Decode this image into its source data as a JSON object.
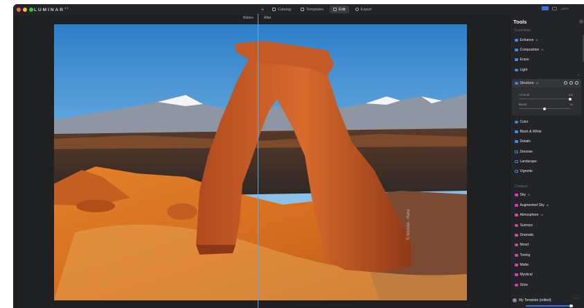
{
  "app": {
    "name": "LUMINAR",
    "version": "4.3"
  },
  "window": {
    "lights": [
      "#ff5f57",
      "#febc2e",
      "#28c840"
    ]
  },
  "nav": {
    "items": [
      {
        "label": "Catalog",
        "icon": "catalog-icon",
        "active": false
      },
      {
        "label": "Templates",
        "icon": "templates-icon",
        "active": false
      },
      {
        "label": "Edit",
        "icon": "edit-icon",
        "active": true
      },
      {
        "label": "Export",
        "icon": "export-icon",
        "active": false
      }
    ],
    "zoom": "100%"
  },
  "compare": {
    "before": "Before",
    "after": "After"
  },
  "photo": {
    "credit": "© Nicolás - Kenz"
  },
  "panel": {
    "title": "Tools",
    "sections": [
      {
        "name": "Essentials",
        "items": [
          {
            "label": "Enhance",
            "ai": "AI",
            "color": "#3c8dde"
          },
          {
            "label": "Composition",
            "ai": "AI",
            "color": "#3c8dde"
          },
          {
            "label": "Erase",
            "ai": "",
            "color": "#3c8dde"
          },
          {
            "label": "Light",
            "ai": "",
            "color": "#3c8dde"
          },
          {
            "label": "Structure",
            "ai": "AI",
            "color": "#3c8dde"
          },
          {
            "label": "Color",
            "ai": "",
            "color": "#3c8dde"
          },
          {
            "label": "Black & White",
            "ai": "",
            "color": "#3c8dde"
          },
          {
            "label": "Details",
            "ai": "",
            "color": "#3c8dde"
          },
          {
            "label": "Denoise",
            "ai": "",
            "color": "#3c8dde"
          },
          {
            "label": "Landscape",
            "ai": "",
            "color": "#3c8dde"
          },
          {
            "label": "Vignette",
            "ai": "",
            "color": "#3c8dde"
          }
        ]
      },
      {
        "name": "Creative",
        "items": [
          {
            "label": "Sky",
            "ai": "AI",
            "color": "#d1489e"
          },
          {
            "label": "Augmented Sky",
            "ai": "AI",
            "color": "#d1489e"
          },
          {
            "label": "Atmosphere",
            "ai": "AI",
            "color": "#d1489e"
          },
          {
            "label": "Sunrays",
            "ai": "",
            "color": "#d1489e"
          },
          {
            "label": "Dramatic",
            "ai": "",
            "color": "#d1489e"
          },
          {
            "label": "Mood",
            "ai": "",
            "color": "#d1489e"
          },
          {
            "label": "Toning",
            "ai": "",
            "color": "#d1489e"
          },
          {
            "label": "Matte",
            "ai": "",
            "color": "#d1489e"
          },
          {
            "label": "Mystical",
            "ai": "",
            "color": "#d1489e"
          },
          {
            "label": "Glow",
            "ai": "",
            "color": "#d1489e"
          }
        ]
      }
    ],
    "structure": {
      "sliders": [
        {
          "label": "Amount",
          "value": "100",
          "fraction": 1.0
        },
        {
          "label": "Boost",
          "value": "50",
          "fraction": 0.5
        }
      ]
    },
    "template": {
      "label": "My Template (edited)",
      "more": "···",
      "amount": 1.0
    }
  }
}
